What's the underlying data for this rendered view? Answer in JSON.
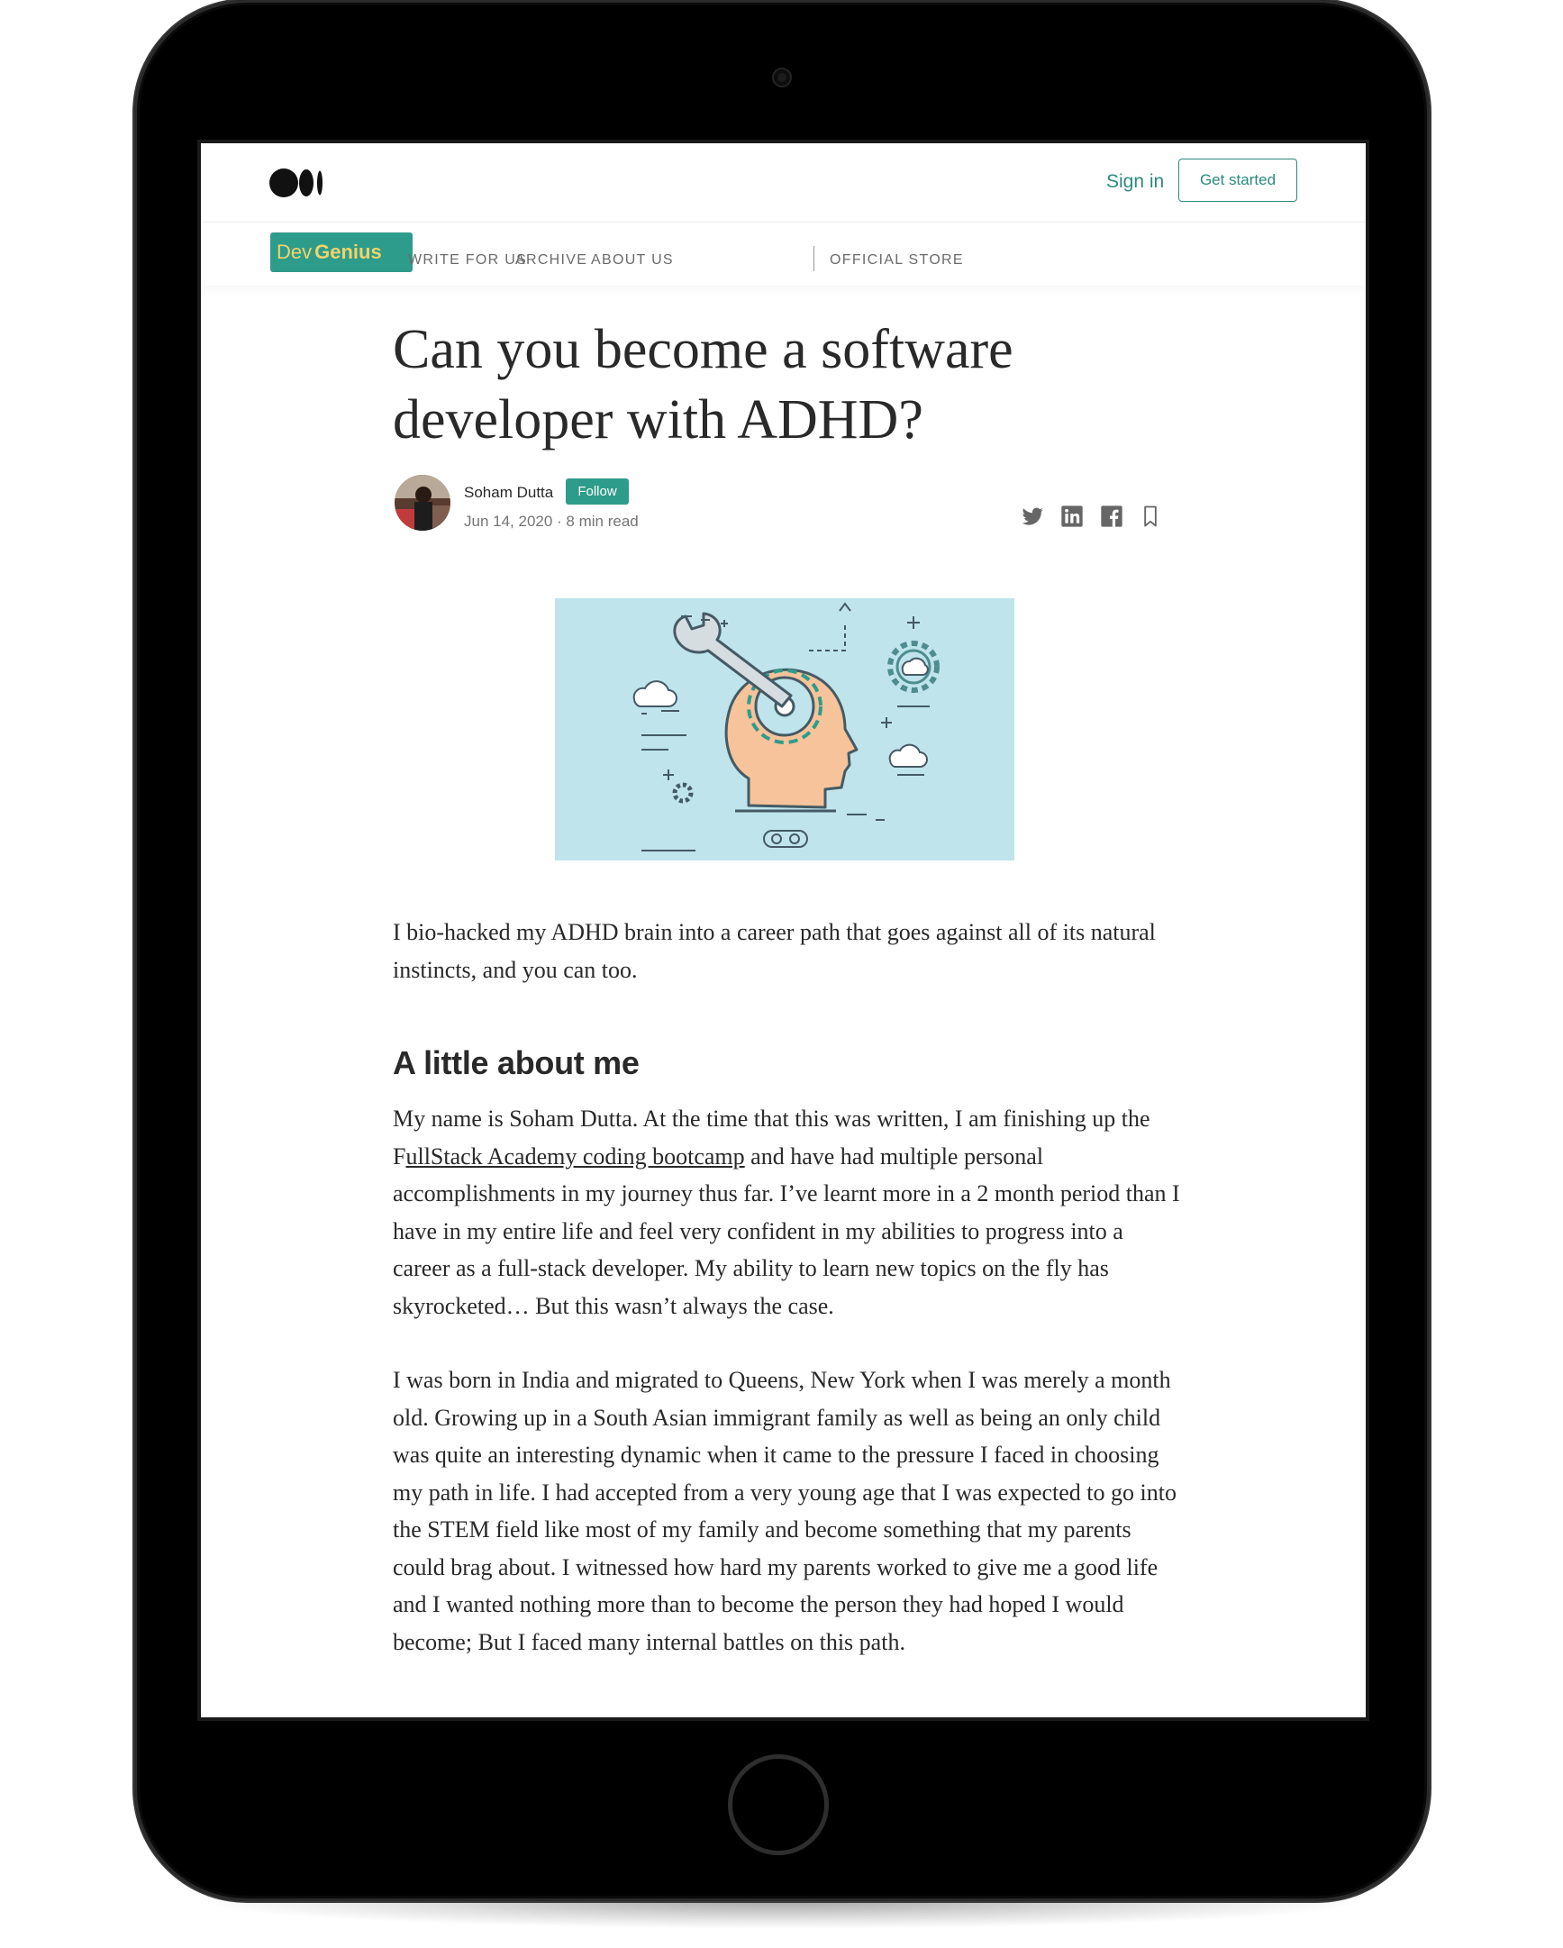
{
  "header": {
    "signin_label": "Sign in",
    "get_started_label": "Get started"
  },
  "publication": {
    "logo_prefix": "Dev",
    "logo_suffix": "Genius",
    "nav": [
      "WRITE FOR US",
      "ARCHIVE",
      "ABOUT US",
      "OFFICIAL STORE"
    ]
  },
  "article": {
    "title_line1": "Can you become a software",
    "title_line2": "developer with ADHD?",
    "author": "Soham Dutta",
    "follow_label": "Follow",
    "meta": "Jun 14, 2020 · 8 min read",
    "intro": "I bio-hacked my ADHD brain into a career path that goes against all of its natural instincts, and you can too.",
    "section_heading": "A little about me",
    "p1_before": "My name is Soham Dutta. At the time that this was written, I am finishing up the F",
    "p1_link": "ullStack Academy coding bootcamp",
    "p1_after": " and have had multiple personal accomplishments in my journey thus far. I’ve learnt more in a 2 month period than I have in my entire life and feel very confident in my abilities to progress into a career as a full-stack developer. My ability to learn new topics on the fly has skyrocketed… But this wasn’t always the case.",
    "p2": "I was born in India and migrated to Queens, New York when I was merely a month old. Growing up in a South Asian immigrant family as well as being an only child was quite an interesting dynamic when it came to the pressure I faced in choosing my path in life. I had accepted from a very young age that I was expected to go into the STEM field like most of my family and become something that my parents could brag about. I witnessed how hard my parents worked to give me a good life and I wanted nothing more than to become the person they had hoped I would become; But I faced many internal battles on this path."
  },
  "colors": {
    "accent": "#2e9c8a",
    "logo_text": "#f2d36b",
    "hero_bg": "#bfe4ec",
    "head_fill": "#f6c39a"
  },
  "icons": [
    "medium-logo",
    "twitter-icon",
    "linkedin-icon",
    "facebook-icon",
    "bookmark-icon"
  ]
}
